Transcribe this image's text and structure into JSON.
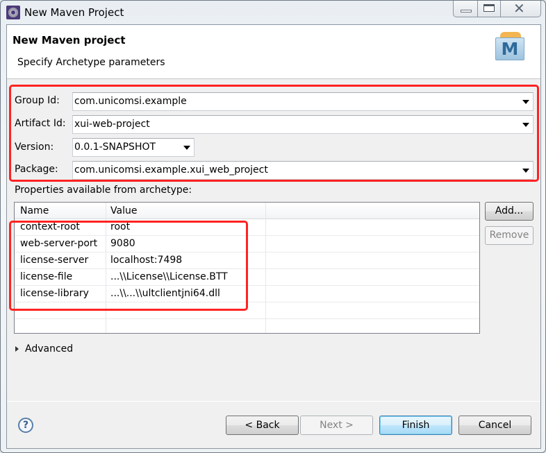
{
  "window": {
    "title": "New Maven Project",
    "controls": {
      "minimize": "minimize",
      "maximize": "maximize",
      "close": "✕"
    }
  },
  "header": {
    "title": "New Maven project",
    "description": "Specify Archetype parameters",
    "logo_letter": "M"
  },
  "form": {
    "group_id": {
      "label": "Group Id:",
      "value": "com.unicomsi.example"
    },
    "artifact_id": {
      "label": "Artifact Id:",
      "value": "xui-web-project"
    },
    "version": {
      "label": "Version:",
      "value": "0.0.1-SNAPSHOT"
    },
    "package": {
      "label": "Package:",
      "value": "com.unicomsi.example.xui_web_project"
    }
  },
  "properties": {
    "label": "Properties available from archetype:",
    "columns": [
      "Name",
      "Value"
    ],
    "rows": [
      {
        "name": "context-root",
        "value": "root"
      },
      {
        "name": "web-server-port",
        "value": "9080"
      },
      {
        "name": "license-server",
        "value": "localhost:7498"
      },
      {
        "name": "license-file",
        "value": "...\\\\License\\\\License.BTT"
      },
      {
        "name": "license-library",
        "value": "...\\\\...\\\\ultclientjni64.dll"
      }
    ],
    "add_label": "Add...",
    "remove_label": "Remove"
  },
  "advanced": {
    "label": "Advanced",
    "expanded": false
  },
  "footer": {
    "help": "?",
    "back_label": "< Back",
    "next_label": "Next >",
    "finish_label": "Finish",
    "cancel_label": "Cancel"
  },
  "colors": {
    "highlight": "#ff2222",
    "default_button": "#3c7fb1"
  }
}
